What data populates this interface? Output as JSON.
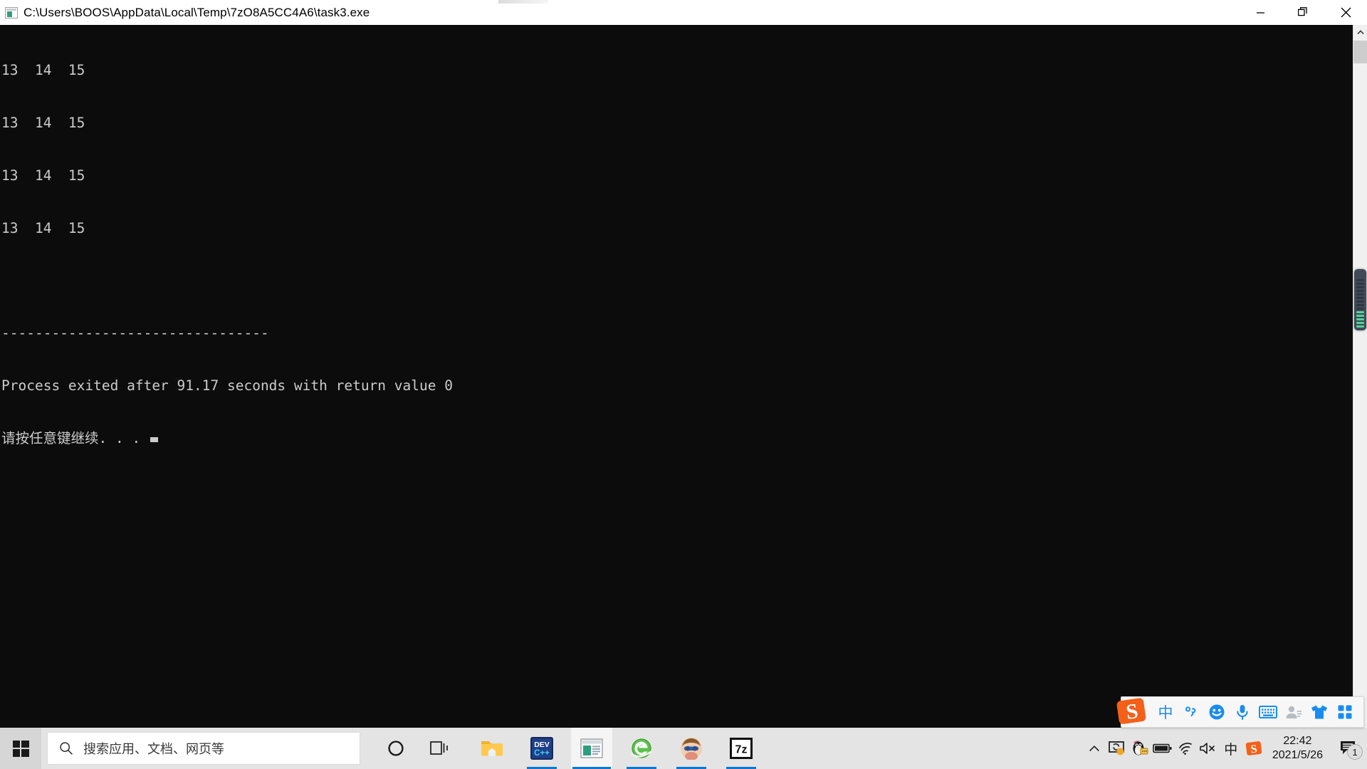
{
  "window": {
    "title": "C:\\Users\\BOOS\\AppData\\Local\\Temp\\7zO8A5CC4A6\\task3.exe",
    "icon": "console-window-icon",
    "minimize_label": "Minimize",
    "restore_label": "Restore",
    "close_label": "Close"
  },
  "console": {
    "lines": [
      "13  14  15",
      "13  14  15",
      "13  14  15",
      "13  14  15",
      "",
      "--------------------------------",
      "Process exited after 91.17 seconds with return value 0",
      "请按任意键继续. . ."
    ],
    "exit_seconds": "91.17",
    "return_value": "0",
    "press_any_key": "请按任意键继续. . .",
    "foreground_color": "#cccccc",
    "background_color": "#0c0c0c"
  },
  "scrollbar": {
    "up_arrow": "scroll-up-arrow",
    "down_arrow": "scroll-down-arrow"
  },
  "side_gauge": {
    "name": "performance-gauge-widget",
    "segments_total": 14,
    "segments_on": 5,
    "on_color": "#4fd49a"
  },
  "taskbar": {
    "start_label": "Start",
    "search": {
      "placeholder": "搜索应用、文档、网页等",
      "icon": "search-icon"
    },
    "buttons": [
      {
        "name": "cortana-button",
        "label": "Cortana"
      },
      {
        "name": "task-view-button",
        "label": "Task View"
      }
    ],
    "apps": [
      {
        "name": "taskbar-app-file-explorer",
        "label": "文件资源管理器",
        "running": false,
        "active": false
      },
      {
        "name": "taskbar-app-dev-cpp",
        "label": "Dev-C++",
        "running": true,
        "active": false
      },
      {
        "name": "taskbar-app-console",
        "label": "task3.exe",
        "running": true,
        "active": true
      },
      {
        "name": "taskbar-app-internet-explorer",
        "label": "Internet Explorer",
        "running": true,
        "active": false
      },
      {
        "name": "taskbar-app-avatar-app",
        "label": "QQ",
        "running": true,
        "active": false
      },
      {
        "name": "taskbar-app-7zip",
        "label": "7-Zip",
        "running": true,
        "active": false
      }
    ],
    "tray": [
      {
        "name": "show-hidden-icons-chevron",
        "label": "显示隐藏的图标"
      },
      {
        "name": "screen-capture-icon",
        "label": "截图工具"
      },
      {
        "name": "qq-penguin-icon",
        "label": "QQ"
      },
      {
        "name": "battery-icon",
        "label": "电池"
      },
      {
        "name": "wifi-icon",
        "label": "网络"
      },
      {
        "name": "volume-muted-icon",
        "label": "音量已静音"
      },
      {
        "name": "ime-mode-indicator",
        "label": "中"
      },
      {
        "name": "sogou-tray-icon",
        "label": "搜狗输入法"
      }
    ],
    "clock": {
      "time": "22:42",
      "date": "2021/5/26"
    },
    "notifications": {
      "icon": "action-center-icon",
      "count": "1"
    }
  },
  "ime_bar": {
    "logo": "sogou-logo-icon",
    "items": [
      {
        "name": "ime-language-toggle",
        "glyph": "中",
        "label": "中文"
      },
      {
        "name": "ime-punctuation-toggle",
        "glyph": "°,",
        "label": "中文标点"
      },
      {
        "name": "ime-emoji-button",
        "glyph": "",
        "label": "表情"
      },
      {
        "name": "ime-voice-input-button",
        "glyph": "",
        "label": "语音输入"
      },
      {
        "name": "ime-soft-keyboard-button",
        "glyph": "",
        "label": "软键盘"
      },
      {
        "name": "ime-user-button",
        "glyph": "",
        "label": "个人中心"
      },
      {
        "name": "ime-skin-button",
        "glyph": "",
        "label": "换肤"
      },
      {
        "name": "ime-toolbox-button",
        "glyph": "",
        "label": "工具箱"
      }
    ]
  },
  "colors": {
    "accent": "#0a78d4",
    "taskbar_bg": "#e4e4e4",
    "ime_blue": "#1a8cf0",
    "sogou_orange": "#f4601a"
  }
}
